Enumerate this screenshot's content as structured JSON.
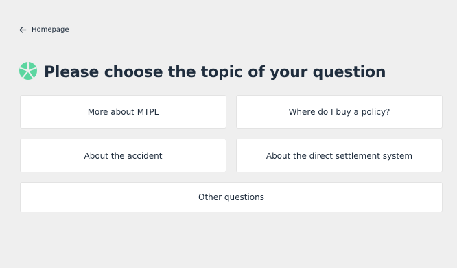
{
  "nav": {
    "back_label": "Homepage",
    "back_icon": "arrow-left-icon"
  },
  "header": {
    "title": "Please choose the topic of your question",
    "logo_icon": "logo-icon",
    "accent_color": "#5cd6a0"
  },
  "topics": [
    {
      "label": "More about MTPL"
    },
    {
      "label": "Where do I buy a policy?"
    },
    {
      "label": "About the accident"
    },
    {
      "label": "About the direct settlement system"
    },
    {
      "label": "Other questions"
    }
  ]
}
